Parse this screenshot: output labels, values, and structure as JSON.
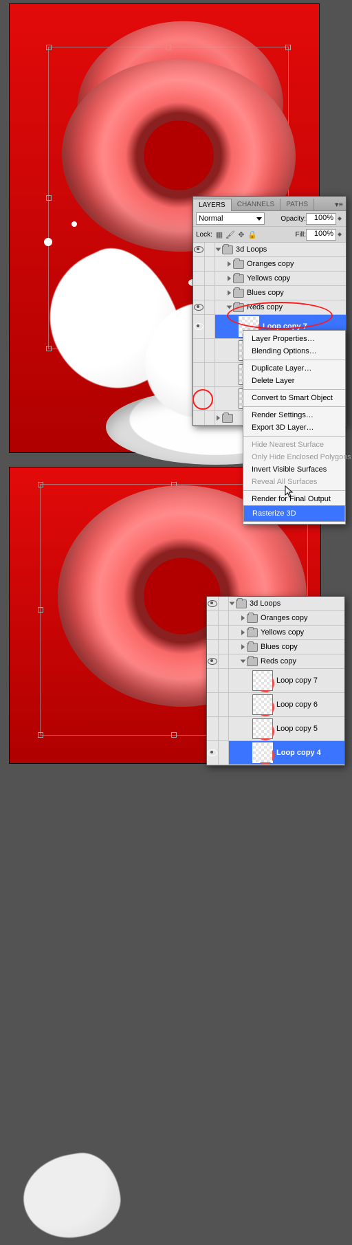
{
  "panel": {
    "tabs": {
      "layers": "LAYERS",
      "channels": "CHANNELS",
      "paths": "PATHS"
    },
    "blend_label": "Normal",
    "opacity_label": "Opacity:",
    "opacity_value": "100%",
    "lock_label": "Lock:",
    "fill_label": "Fill:",
    "fill_value": "100%"
  },
  "layers_top": {
    "root": "3d Loops",
    "groups": [
      "Oranges copy",
      "Yellows copy",
      "Blues copy",
      "Reds copy"
    ],
    "selected": "Loop copy 7"
  },
  "ctx": {
    "items": [
      "Layer Properties…",
      "Blending Options…",
      "Duplicate Layer…",
      "Delete Layer",
      "Convert to Smart Object",
      "Render Settings…",
      "Export 3D Layer…",
      "Hide Nearest Surface",
      "Only Hide Enclosed Polygons",
      "Invert Visible Surfaces",
      "Reveal All Surfaces",
      "Render for Final Output",
      "Rasterize 3D"
    ]
  },
  "layers_bot": {
    "root": "3d Loops",
    "groups": [
      "Oranges copy",
      "Yellows copy",
      "Blues copy",
      "Reds copy"
    ],
    "items": [
      "Loop copy 7",
      "Loop copy 6",
      "Loop copy 5",
      "Loop copy 4"
    ],
    "selected": "Loop copy 4"
  }
}
